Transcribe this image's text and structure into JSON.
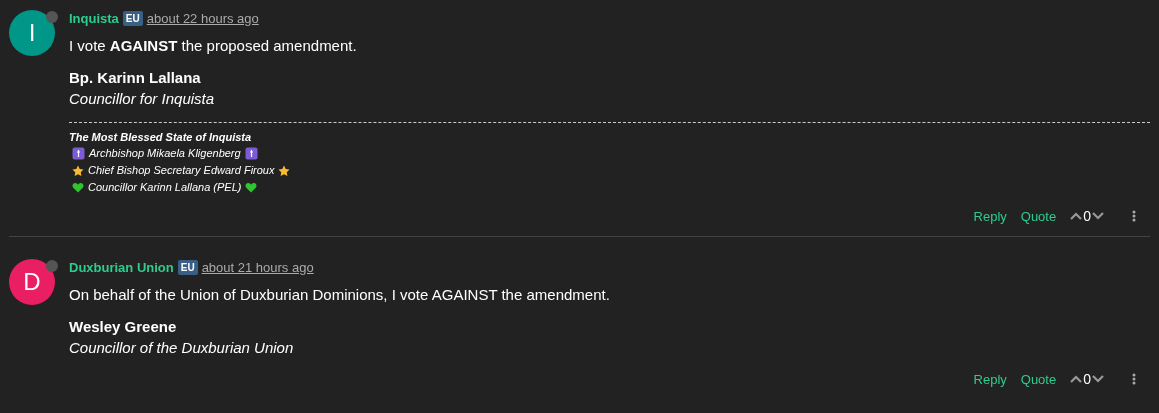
{
  "comments": [
    {
      "avatar": {
        "letter": "I",
        "color": "#009688",
        "online": false
      },
      "author": "Inquista",
      "tag": "EU",
      "time": "about 22 hours ago",
      "body": [
        {
          "kind": "text",
          "text": "I vote **AGAINST** the proposed amendment."
        },
        {
          "kind": "bold",
          "text": "Bp. Karinn Lallana"
        },
        {
          "kind": "italic",
          "text": "Councillor for Inquista"
        }
      ],
      "signature": {
        "title": "The Most Blessed State of Inquista",
        "lines": [
          {
            "kind": "badge",
            "text": "Archbishop Mikaela Kligenberg"
          },
          {
            "kind": "star",
            "text": "Chief Bishop Secretary Edward Firoux"
          },
          {
            "kind": "heart",
            "text": "Councillor Karinn Lallana (PEL)"
          }
        ]
      },
      "actions": [
        "Reply",
        "Quote"
      ],
      "score": "0"
    },
    {
      "avatar": {
        "letter": "D",
        "color": "#e91e63",
        "online": false
      },
      "author": "Duxburian Union",
      "tag": "EU",
      "time": "about 21 hours ago",
      "body": [
        {
          "kind": "text",
          "text": "On behalf of the Union of Duxburian Dominions, I vote AGAINST the amendment."
        },
        {
          "kind": "bold",
          "text": "Wesley Greene"
        },
        {
          "kind": "italic",
          "text": "Councillor of the Duxburian Union"
        }
      ],
      "actions": [
        "Reply",
        "Quote"
      ],
      "score": "0"
    }
  ]
}
